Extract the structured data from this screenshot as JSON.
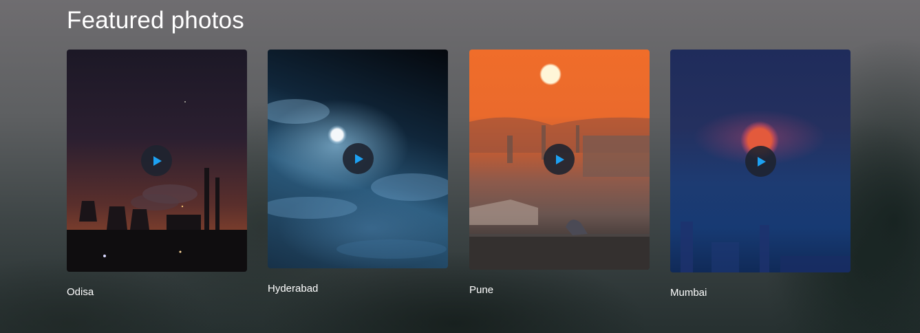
{
  "section": {
    "title": "Featured photos"
  },
  "cards": [
    {
      "label": "Odisa",
      "play_icon": "play-icon"
    },
    {
      "label": "Hyderabad",
      "play_icon": "play-icon"
    },
    {
      "label": "Pune",
      "play_icon": "play-icon"
    },
    {
      "label": "Mumbai",
      "play_icon": "play-icon"
    }
  ],
  "colors": {
    "accent": "#1da1f2",
    "text": "#ffffff",
    "play_button_bg": "#1e2430"
  }
}
